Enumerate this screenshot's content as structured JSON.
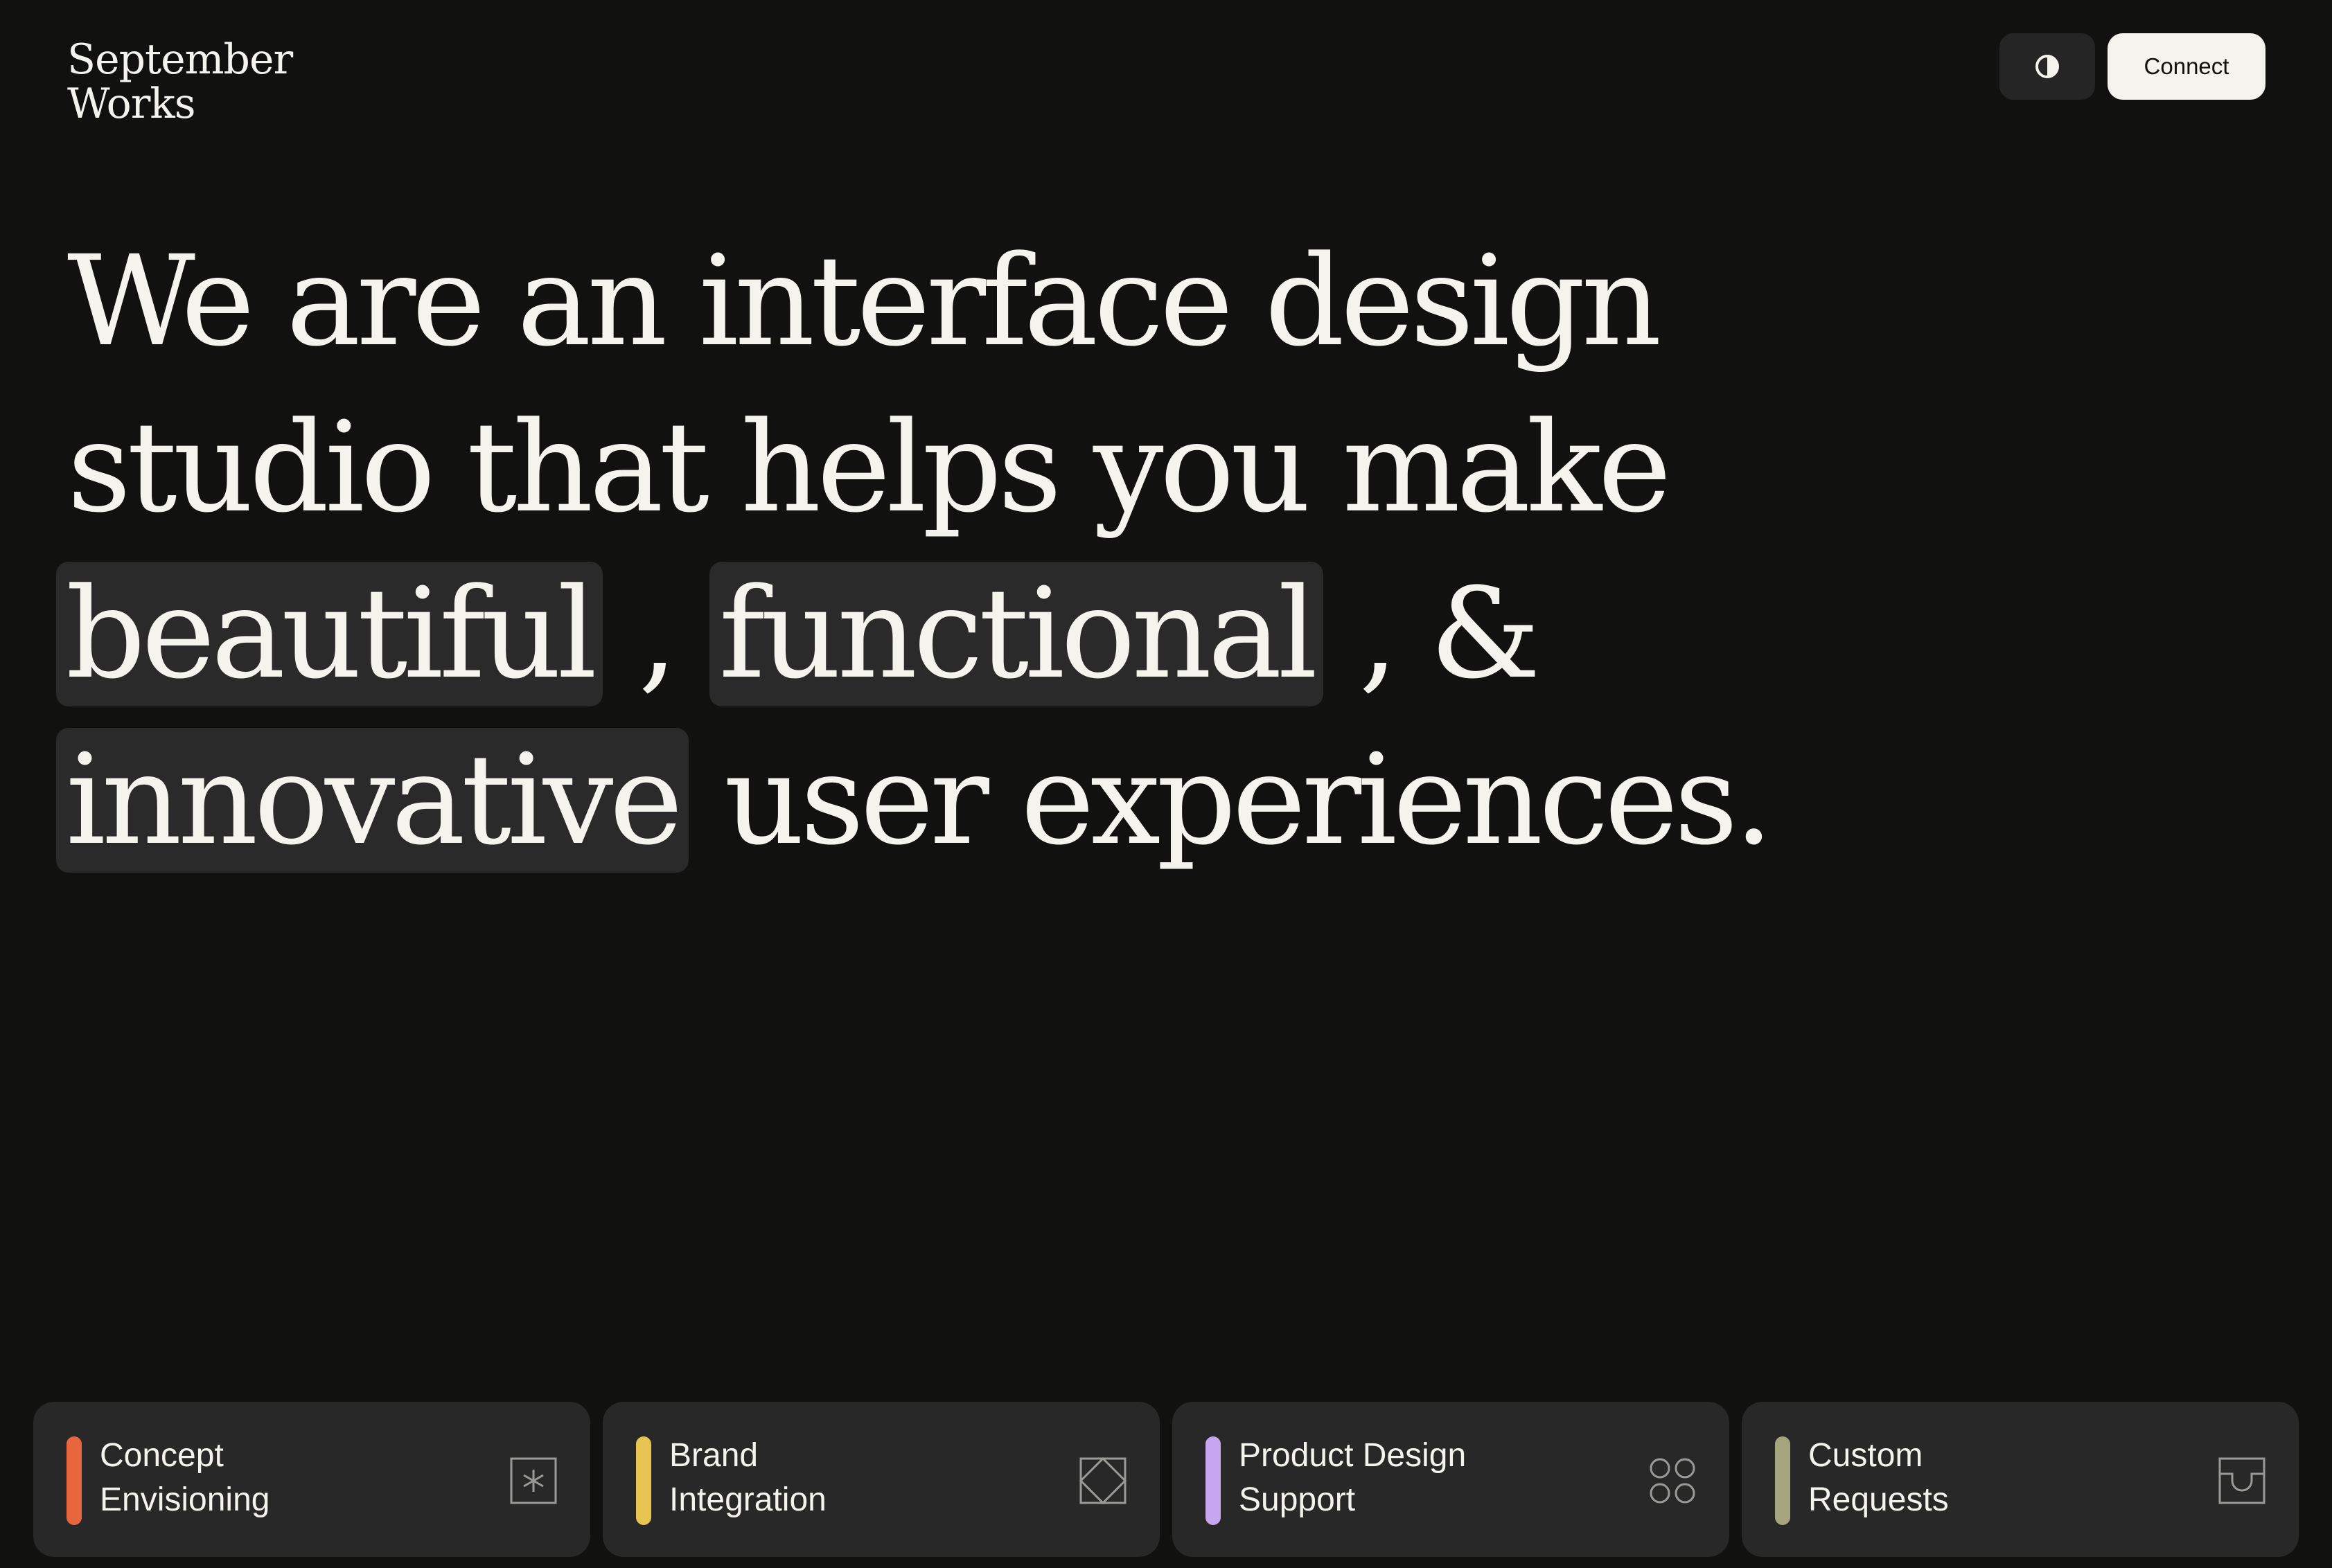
{
  "brand": {
    "line1": "September",
    "line2": "Works"
  },
  "header": {
    "theme_toggle_icon": "contrast-icon",
    "connect_label": "Connect"
  },
  "hero": {
    "line1": "We are an interface design",
    "line2": "studio that helps you make",
    "word_beautiful": "beautiful",
    "comma1": " , ",
    "word_functional": "functional",
    "comma2": " , &",
    "word_innovative": "innovative",
    "tail": " user experiences."
  },
  "services": [
    {
      "line1": "Concept",
      "line2": "Envisioning",
      "accent": "#e8663d",
      "icon": "asterisk-square-icon"
    },
    {
      "line1": "Brand",
      "line2": "Integration",
      "accent": "#e8c552",
      "icon": "diamond-square-icon"
    },
    {
      "line1": "Product Design",
      "line2": "Support",
      "accent": "#c7a6f0",
      "icon": "four-circles-icon"
    },
    {
      "line1": "Custom",
      "line2": "Requests",
      "accent": "#a5a57e",
      "icon": "tray-icon"
    }
  ],
  "colors": {
    "background": "#111110",
    "text": "#f4f3ee",
    "highlight": "#2a2a2a",
    "card": "#282828"
  }
}
